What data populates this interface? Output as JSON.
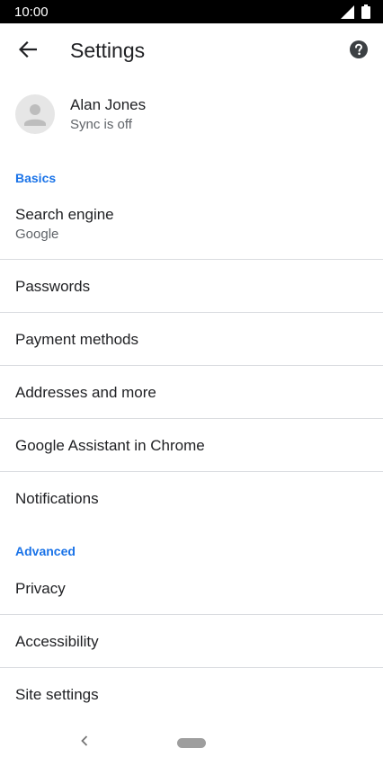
{
  "status_bar": {
    "time": "10:00",
    "icons": [
      "signal-icon",
      "battery-icon"
    ]
  },
  "header": {
    "back_icon": "arrow-left-icon",
    "title": "Settings",
    "help_icon": "help-circle-icon"
  },
  "account": {
    "name": "Alan Jones",
    "sync_status": "Sync is off",
    "avatar_icon": "person-avatar-icon"
  },
  "sections": {
    "basics": "Basics",
    "advanced": "Advanced"
  },
  "items": {
    "search_engine": {
      "label": "Search engine",
      "value": "Google"
    },
    "passwords": "Passwords",
    "payment_methods": "Payment methods",
    "addresses": "Addresses and more",
    "assistant": "Google Assistant in Chrome",
    "notifications": "Notifications",
    "privacy": "Privacy",
    "accessibility": "Accessibility",
    "site_settings": "Site settings"
  },
  "nav_bar": {
    "back_icon": "chevron-left-icon",
    "home_icon": "home-pill-icon"
  },
  "colors": {
    "accent": "#1a73e8",
    "status_bar": "#000000",
    "divider": "#dadce0",
    "secondary_text": "#5f6368"
  }
}
